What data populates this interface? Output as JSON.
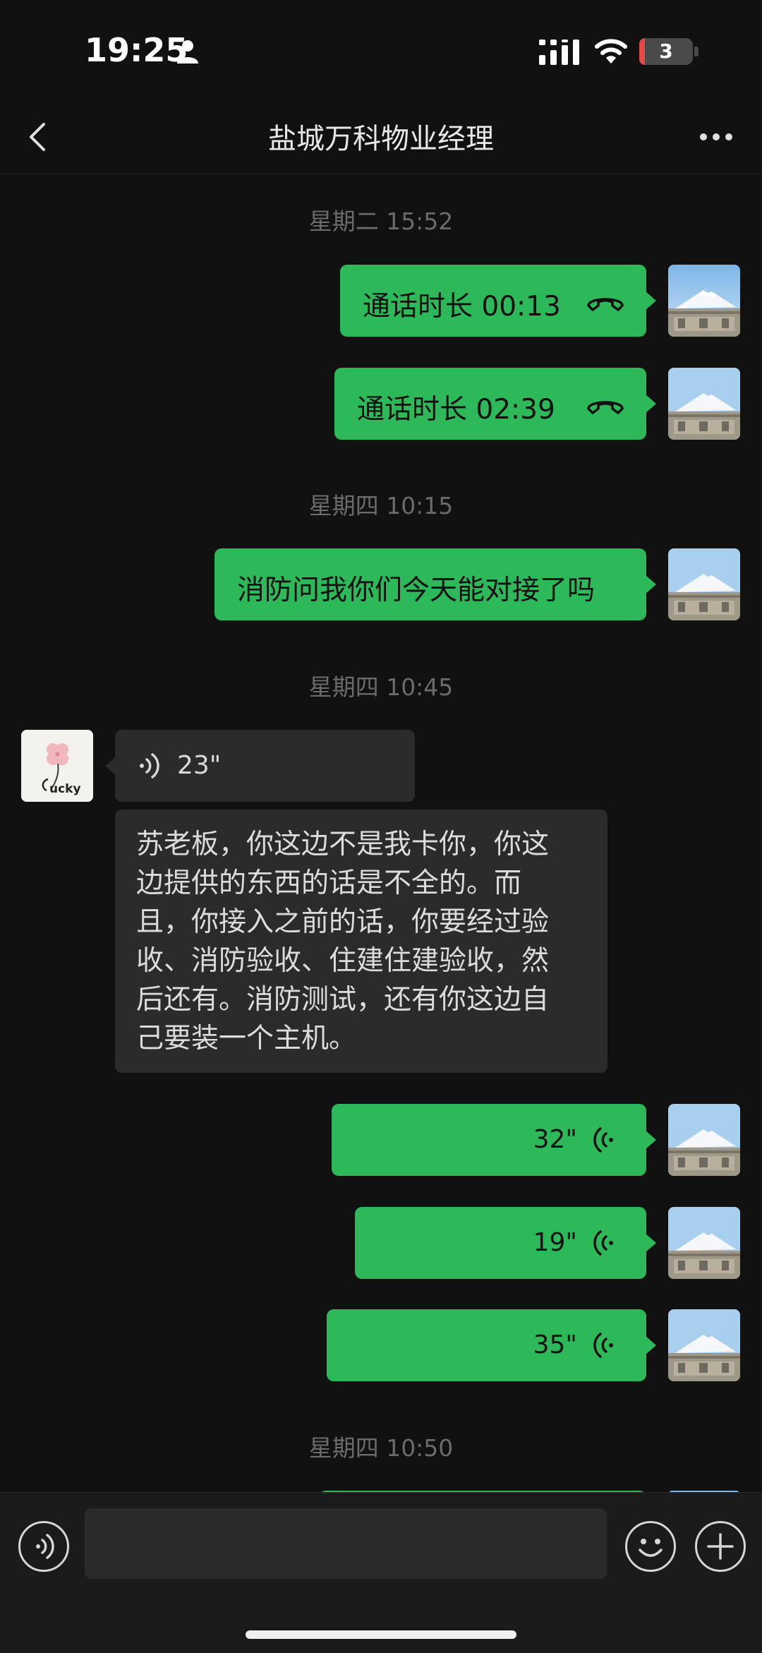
{
  "status_bar": {
    "time": "19:25",
    "battery_level": "3",
    "person_icon": "person-icon",
    "signal_icon": "cellular-signal-icon",
    "wifi_icon": "wifi-icon"
  },
  "header": {
    "title": "盐城万科物业经理",
    "back_icon": "chevron-left-icon",
    "more_icon": "more-dots-icon"
  },
  "timestamps": [
    "星期二 15:52",
    "星期四 10:15",
    "星期四 10:45",
    "星期四 10:50"
  ],
  "messages": [
    {
      "from": "me",
      "type": "call",
      "text": "通话时长 00:13",
      "icon": "hang-up-icon"
    },
    {
      "from": "me",
      "type": "call",
      "text": "通话时长 02:39",
      "icon": "hang-up-icon"
    },
    {
      "from": "me",
      "type": "text",
      "text": "消防问我你们今天能对接了吗"
    },
    {
      "from": "peer",
      "type": "voice",
      "duration": "23\"",
      "icon": "voice-icon"
    },
    {
      "from": "peer",
      "type": "transcript",
      "text": "苏老板，你这边不是我卡你，你这边提供的东西的话是不全的。而且，你接入之前的话，你要经过验收、消防验收、住建住建验收，然后还有。消防测试，还有你这边自己要装一个主机。"
    },
    {
      "from": "me",
      "type": "voice",
      "duration": "32\"",
      "icon": "voice-icon"
    },
    {
      "from": "me",
      "type": "voice",
      "duration": "19\"",
      "icon": "voice-icon"
    },
    {
      "from": "me",
      "type": "voice",
      "duration": "35\"",
      "icon": "voice-icon"
    }
  ],
  "peer_avatar": {
    "text": "ucky"
  },
  "input_bar": {
    "voice_button_icon": "voice-mode-icon",
    "emoji_button_icon": "emoji-icon",
    "plus_button_icon": "plus-icon"
  },
  "colors": {
    "bubble_self": "#2db85a",
    "bubble_peer": "#2b2b2b",
    "background": "#111111"
  }
}
